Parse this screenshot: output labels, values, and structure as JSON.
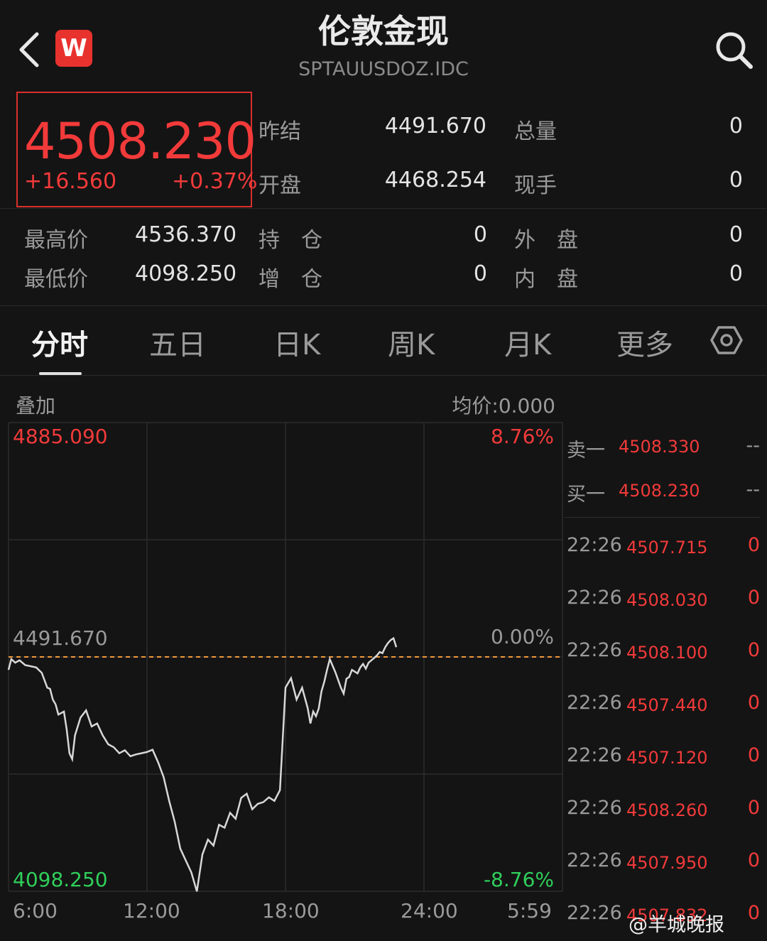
{
  "header": {
    "title": "伦敦金现",
    "code": "SPTAUUSDOZ.IDC",
    "logo_text": "W"
  },
  "quote": {
    "price": "4508.230",
    "change": "+16.560",
    "change_pct": "+0.37%",
    "stats_top": [
      {
        "label": "昨结",
        "value": "4491.670",
        "label2": "总量",
        "value2": "0"
      },
      {
        "label": "开盘",
        "value": "4468.254",
        "label2": "现手",
        "value2": "0"
      }
    ],
    "stats_bottom": [
      {
        "label": "最高价",
        "value": "4536.370",
        "label2": "持　仓",
        "value2": "0",
        "label3": "外　盘",
        "value3": "0"
      },
      {
        "label": "最低价",
        "value": "4098.250",
        "label2": "增　仓",
        "value2": "0",
        "label3": "内　盘",
        "value3": "0"
      }
    ]
  },
  "tabs": [
    "分时",
    "五日",
    "日K",
    "周K",
    "月K",
    "更多"
  ],
  "chart_header": {
    "overlay": "叠加",
    "avg_price": "均价:0.000"
  },
  "chart_data": {
    "type": "line",
    "title": "",
    "x_ticks": [
      "6:00",
      "12:00",
      "18:00",
      "24:00",
      "5:59"
    ],
    "ylim": [
      4098.25,
      4885.09
    ],
    "y_top_label": "4885.090",
    "y_bottom_label": "4098.250",
    "ref_label": "4491.670",
    "ref_value": 4491.67,
    "pct_top": "8.76%",
    "pct_mid": "0.00%",
    "pct_bottom": "-8.76%",
    "grid": true,
    "series": [
      {
        "x": [
          0,
          0.005,
          0.012,
          0.02,
          0.03,
          0.04,
          0.05,
          0.06,
          0.07,
          0.075,
          0.08,
          0.085,
          0.09,
          0.1,
          0.105,
          0.11,
          0.115,
          0.12,
          0.13,
          0.14,
          0.15,
          0.16,
          0.17,
          0.18,
          0.19,
          0.2,
          0.21,
          0.22,
          0.23,
          0.24,
          0.25,
          0.26,
          0.27,
          0.28,
          0.29,
          0.3,
          0.31,
          0.32,
          0.33,
          0.34,
          0.35,
          0.36,
          0.37,
          0.38,
          0.39,
          0.4,
          0.41,
          0.42,
          0.43,
          0.44,
          0.45,
          0.46,
          0.47,
          0.48,
          0.49,
          0.5,
          0.51,
          0.52,
          0.53,
          0.54,
          0.545,
          0.55,
          0.555,
          0.56,
          0.565,
          0.57,
          0.575,
          0.58,
          0.59,
          0.6,
          0.605,
          0.61,
          0.615,
          0.62,
          0.63,
          0.635,
          0.64,
          0.645,
          0.65,
          0.655,
          0.66,
          0.665,
          0.67,
          0.675,
          0.68,
          0.685,
          0.69,
          0.695,
          0.7
        ],
        "y": [
          4470,
          4488,
          4482,
          4486,
          4478,
          4476,
          4474,
          4465,
          4440,
          4438,
          4420,
          4412,
          4395,
          4400,
          4370,
          4330,
          4320,
          4360,
          4390,
          4402,
          4375,
          4380,
          4360,
          4345,
          4340,
          4330,
          4335,
          4325,
          4328,
          4330,
          4332,
          4336,
          4315,
          4290,
          4250,
          4215,
          4170,
          4150,
          4130,
          4098,
          4160,
          4185,
          4175,
          4210,
          4205,
          4230,
          4220,
          4255,
          4262,
          4236,
          4245,
          4248,
          4256,
          4250,
          4268,
          4440,
          4456,
          4420,
          4440,
          4406,
          4380,
          4400,
          4392,
          4405,
          4434,
          4450,
          4470,
          4488,
          4466,
          4440,
          4430,
          4455,
          4458,
          4470,
          4464,
          4474,
          4480,
          4472,
          4482,
          4486,
          4490,
          4494,
          4500,
          4498,
          4508,
          4515,
          4520,
          4523,
          4508
        ]
      }
    ]
  },
  "order_book": {
    "sell1": {
      "label": "卖一",
      "price": "4508.330",
      "vol": "--"
    },
    "buy1": {
      "label": "买一",
      "price": "4508.230",
      "vol": "--"
    },
    "trades": [
      {
        "time": "22:26",
        "price": "4507.715",
        "vol": "0"
      },
      {
        "time": "22:26",
        "price": "4508.030",
        "vol": "0"
      },
      {
        "time": "22:26",
        "price": "4508.100",
        "vol": "0"
      },
      {
        "time": "22:26",
        "price": "4507.440",
        "vol": "0"
      },
      {
        "time": "22:26",
        "price": "4507.120",
        "vol": "0"
      },
      {
        "time": "22:26",
        "price": "4508.260",
        "vol": "0"
      },
      {
        "time": "22:26",
        "price": "4507.950",
        "vol": "0"
      },
      {
        "time": "22:26",
        "price": "4507.832",
        "vol": "0"
      }
    ]
  },
  "watermark": "@羊城晚报",
  "colors": {
    "up": "#f23a3a",
    "down": "#2fcf5a",
    "ref_line": "#f09a3a",
    "bg": "#141414"
  }
}
